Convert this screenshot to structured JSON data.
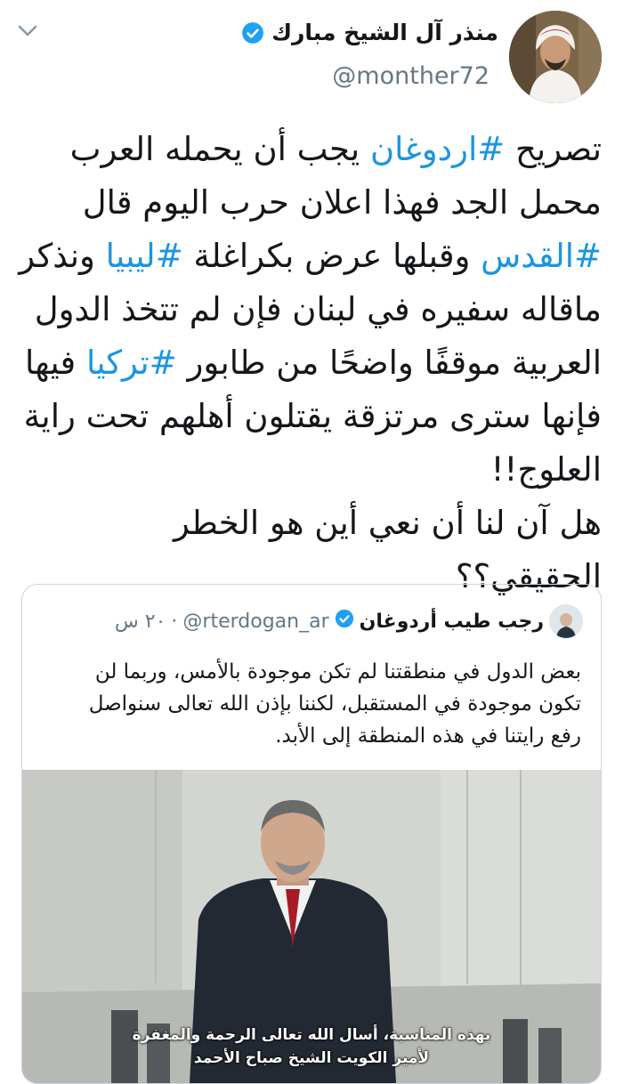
{
  "header": {
    "display_name": "منذر آل الشيخ مبارك",
    "handle": "@monther72",
    "verified": true,
    "more_icon": "chevron-down-icon"
  },
  "tweet": {
    "lines": [
      {
        "parts": [
          {
            "t": "تصريح "
          },
          {
            "t": "#اردوغان",
            "tag": true
          },
          {
            "t": " يجب أن يحمله العرب"
          }
        ]
      },
      {
        "parts": [
          {
            "t": "محمل الجد فهذا اعلان حرب اليوم قال"
          }
        ]
      },
      {
        "parts": [
          {
            "t": "#القدس",
            "tag": true
          },
          {
            "t": " وقبلها عرض بكراغلة "
          },
          {
            "t": "#ليبيا",
            "tag": true
          },
          {
            "t": "  ونذكر"
          }
        ]
      },
      {
        "parts": [
          {
            "t": "ماقاله سفيره في لبنان فإن لم تتخذ الدول"
          }
        ]
      },
      {
        "parts": [
          {
            "t": "العربية موقفًا واضحًا من طابور "
          },
          {
            "t": "#تركيا",
            "tag": true
          },
          {
            "t": " فيها"
          }
        ]
      },
      {
        "parts": [
          {
            "t": "فإنها سترى مرتزقة يقتلون أهلهم تحت راية"
          }
        ]
      },
      {
        "parts": [
          {
            "t": "العلوج!!"
          }
        ]
      },
      {
        "parts": [
          {
            "t": "هل آن لنا أن نعي أين هو الخطر الحقيقي؟؟"
          }
        ]
      }
    ]
  },
  "quoted_tweet": {
    "display_name": "رجب طيب أردوغان",
    "handle": "@rterdogan_ar",
    "separator": "·",
    "time": "٢٠ س",
    "verified": true,
    "text_lines": [
      "بعض الدول في منطقتنا لم تكن موجودة بالأمس، وربما لن",
      "تكون موجودة في المستقبل، لكننا بإذن الله تعالى سنواصل",
      "رفع رايتنا في هذه المنطقة إلى الأبد."
    ],
    "media": {
      "subtitle_line1": "بهذه المناسبة، أسال الله تعالى الرحمة والمغفرة",
      "subtitle_line2": "لأمير الكويت الشيخ صباح الأحمد"
    }
  },
  "colors": {
    "link": "#1b95e0",
    "verified": "#1da1f2",
    "secondary_text": "#657786",
    "border": "#ccd6dd"
  }
}
